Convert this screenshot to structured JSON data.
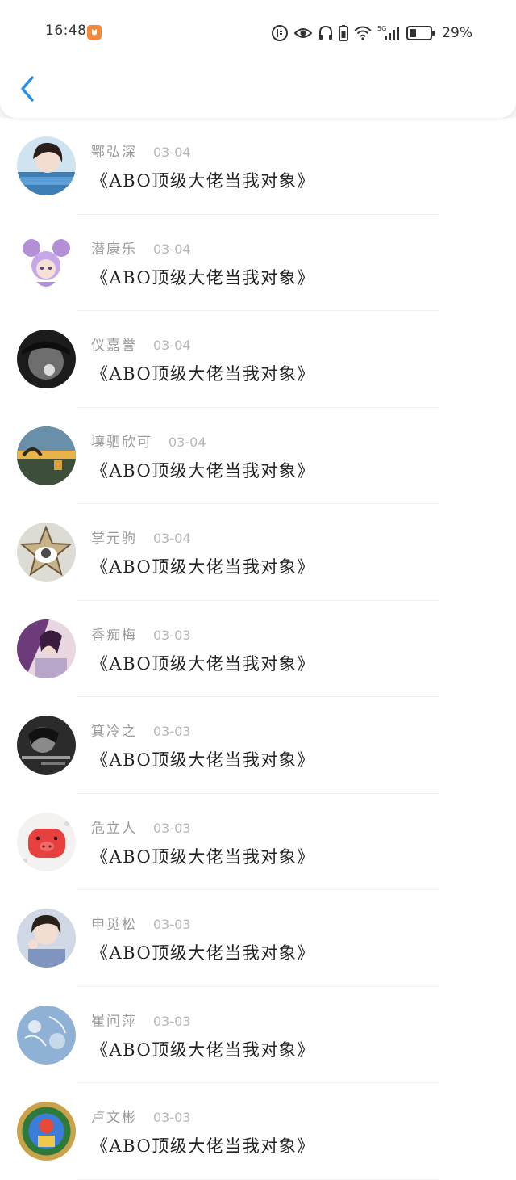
{
  "status_bar": {
    "time": "16:48",
    "battery": "29%",
    "network": "5G"
  },
  "nav": {
    "back_icon": "chevron-left-icon",
    "accent": "#2b8fe5"
  },
  "items": [
    {
      "name": "鄂弘深",
      "date": "03-04",
      "title": "《ABO顶级大佬当我对象》"
    },
    {
      "name": "潜康乐",
      "date": "03-04",
      "title": "《ABO顶级大佬当我对象》"
    },
    {
      "name": "仪嘉誉",
      "date": "03-04",
      "title": "《ABO顶级大佬当我对象》"
    },
    {
      "name": "壤驷欣可",
      "date": "03-04",
      "title": "《ABO顶级大佬当我对象》"
    },
    {
      "name": "掌元驹",
      "date": "03-04",
      "title": "《ABO顶级大佬当我对象》"
    },
    {
      "name": "香痴梅",
      "date": "03-03",
      "title": "《ABO顶级大佬当我对象》"
    },
    {
      "name": "箕冷之",
      "date": "03-03",
      "title": "《ABO顶级大佬当我对象》"
    },
    {
      "name": "危立人",
      "date": "03-03",
      "title": "《ABO顶级大佬当我对象》"
    },
    {
      "name": "申觅松",
      "date": "03-03",
      "title": "《ABO顶级大佬当我对象》"
    },
    {
      "name": "崔问萍",
      "date": "03-03",
      "title": "《ABO顶级大佬当我对象》"
    },
    {
      "name": "卢文彬",
      "date": "03-03",
      "title": "《ABO顶级大佬当我对象》"
    }
  ]
}
